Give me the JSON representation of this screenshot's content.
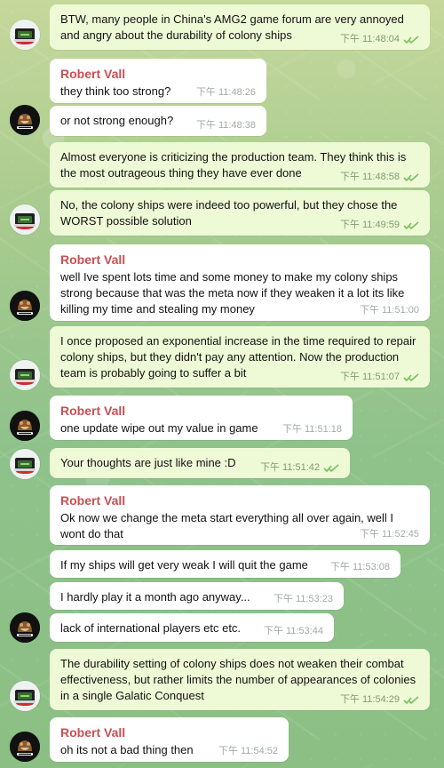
{
  "accent_colors": {
    "sender_name": "#c84f53",
    "outgoing_bubble": "#eefad6",
    "incoming_bubble": "#ffffff",
    "read_check": "#7dbf62"
  },
  "messages": [
    {
      "id": "m1",
      "sender_name": "",
      "text": "BTW, many people in China's AMG2 game forum are very annoyed and angry about the durability of colony ships",
      "time": "下午 11:48:04",
      "read_icon": "double-check-icon"
    },
    {
      "id": "m2",
      "sender_name": "Robert Vall",
      "text": "they think too strong?",
      "time": "下午 11:48:26"
    },
    {
      "id": "m3",
      "sender_name": "",
      "text": "or not strong enough?",
      "time": "下午 11:48:38"
    },
    {
      "id": "m4",
      "sender_name": "",
      "text": "Almost everyone is criticizing the production team. They think this is the most outrageous thing they have ever done",
      "time": "下午 11:48:58",
      "read_icon": "double-check-icon"
    },
    {
      "id": "m5",
      "sender_name": "",
      "text": "No, the colony ships were indeed too powerful, but they chose the WORST possible solution",
      "time": "下午 11:49:59",
      "read_icon": "double-check-icon"
    },
    {
      "id": "m6",
      "sender_name": "Robert Vall",
      "text": "well Ive spent lots time and some money to make my colony ships strong because that was the meta now if they weaken it a lot its like killing my time and stealing my money",
      "time": "下午 11:51:00"
    },
    {
      "id": "m7",
      "sender_name": "",
      "text": "I once proposed an exponential increase in the time required to repair colony ships, but they didn't pay any attention. Now the production team is probably going to suffer a bit",
      "time": "下午 11:51:07",
      "read_icon": "double-check-icon"
    },
    {
      "id": "m8",
      "sender_name": "Robert Vall",
      "text": "one update wipe out my value in game",
      "time": "下午 11:51:18"
    },
    {
      "id": "m9",
      "sender_name": "",
      "text": "Your thoughts are just like mine :D",
      "time": "下午 11:51:42",
      "read_icon": "double-check-icon"
    },
    {
      "id": "m10",
      "sender_name": "Robert Vall",
      "text": "Ok now we change the meta start everything all over again, well I wont do that",
      "time": "下午 11:52:45"
    },
    {
      "id": "m11",
      "sender_name": "",
      "text": "If my ships will get very weak I will quit the game",
      "time": "下午 11:53:08"
    },
    {
      "id": "m12",
      "sender_name": "",
      "text": "I hardly play it a month ago anyway...",
      "time": "下午 11:53:23"
    },
    {
      "id": "m13",
      "sender_name": "",
      "text": "lack of international players etc etc.",
      "time": "下午 11:53:44"
    },
    {
      "id": "m14",
      "sender_name": "",
      "text": "The durability setting of colony ships does not weaken their combat effectiveness, but rather limits the number of appearances of colonies in a single Galatic Conquest",
      "time": "下午 11:54:29",
      "read_icon": "double-check-icon"
    },
    {
      "id": "m15",
      "sender_name": "Robert Vall",
      "text": "oh its not a bad thing then",
      "time": "下午 11:54:52"
    }
  ]
}
